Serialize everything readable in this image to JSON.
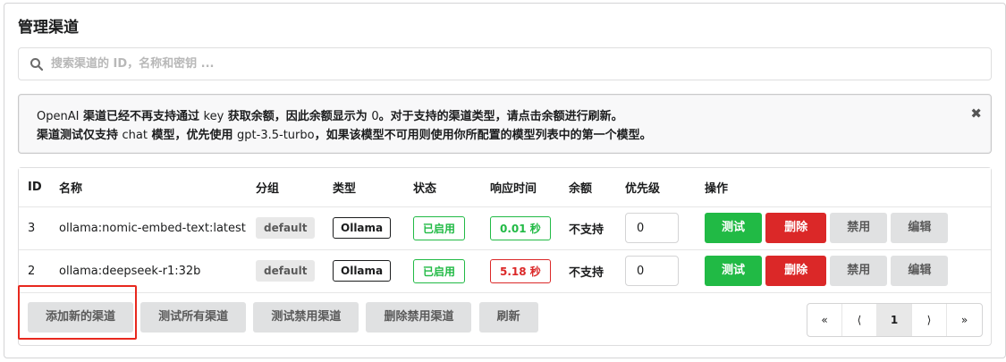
{
  "title": "管理渠道",
  "search": {
    "placeholder": "搜索渠道的 ID，名称和密钥 ..."
  },
  "notice": {
    "line1_a": "OpenAI",
    "line1_b": " 渠道已经不再支持通过 ",
    "line1_c": "key",
    "line1_d": " 获取余额，因此余额显示为 ",
    "line1_e": "0",
    "line1_f": "。对于支持的渠道类型，请点击余额进行刷新。",
    "line2_a": "渠道测试仅支持 ",
    "line2_b": "chat",
    "line2_c": " 模型，优先使用 ",
    "line2_d": "gpt-3.5-turbo",
    "line2_e": "，如果该模型不可用则使用你所配置的模型列表中的第一个模型。",
    "close": "✖"
  },
  "table": {
    "headers": [
      "ID",
      "名称",
      "分组",
      "类型",
      "状态",
      "响应时间",
      "余额",
      "优先级",
      "操作"
    ],
    "rows": [
      {
        "id": "3",
        "name": "ollama:nomic-embed-text:latest",
        "group": "default",
        "type": "Ollama",
        "status": "已启用",
        "response_time": "0.01 秒",
        "response_color": "#21ba45",
        "balance": "不支持",
        "priority": "0"
      },
      {
        "id": "2",
        "name": "ollama:deepseek-r1:32b",
        "group": "default",
        "type": "Ollama",
        "status": "已启用",
        "response_time": "5.18 秒",
        "response_color": "#db2828",
        "balance": "不支持",
        "priority": "0"
      }
    ],
    "actions": {
      "test": "测试",
      "delete": "删除",
      "disable": "禁用",
      "edit": "编辑"
    }
  },
  "footer_buttons": {
    "add": "添加新的渠道",
    "test_all": "测试所有渠道",
    "test_disabled": "测试禁用渠道",
    "delete_disabled": "删除禁用渠道",
    "refresh": "刷新"
  },
  "pagination": {
    "first": "«",
    "prev": "⟨",
    "current": "1",
    "next": "⟩",
    "last": "»"
  },
  "colors": {
    "green": "#21ba45",
    "red": "#db2828",
    "grey": "#e0e1e2",
    "highlight": "#e8281e"
  }
}
